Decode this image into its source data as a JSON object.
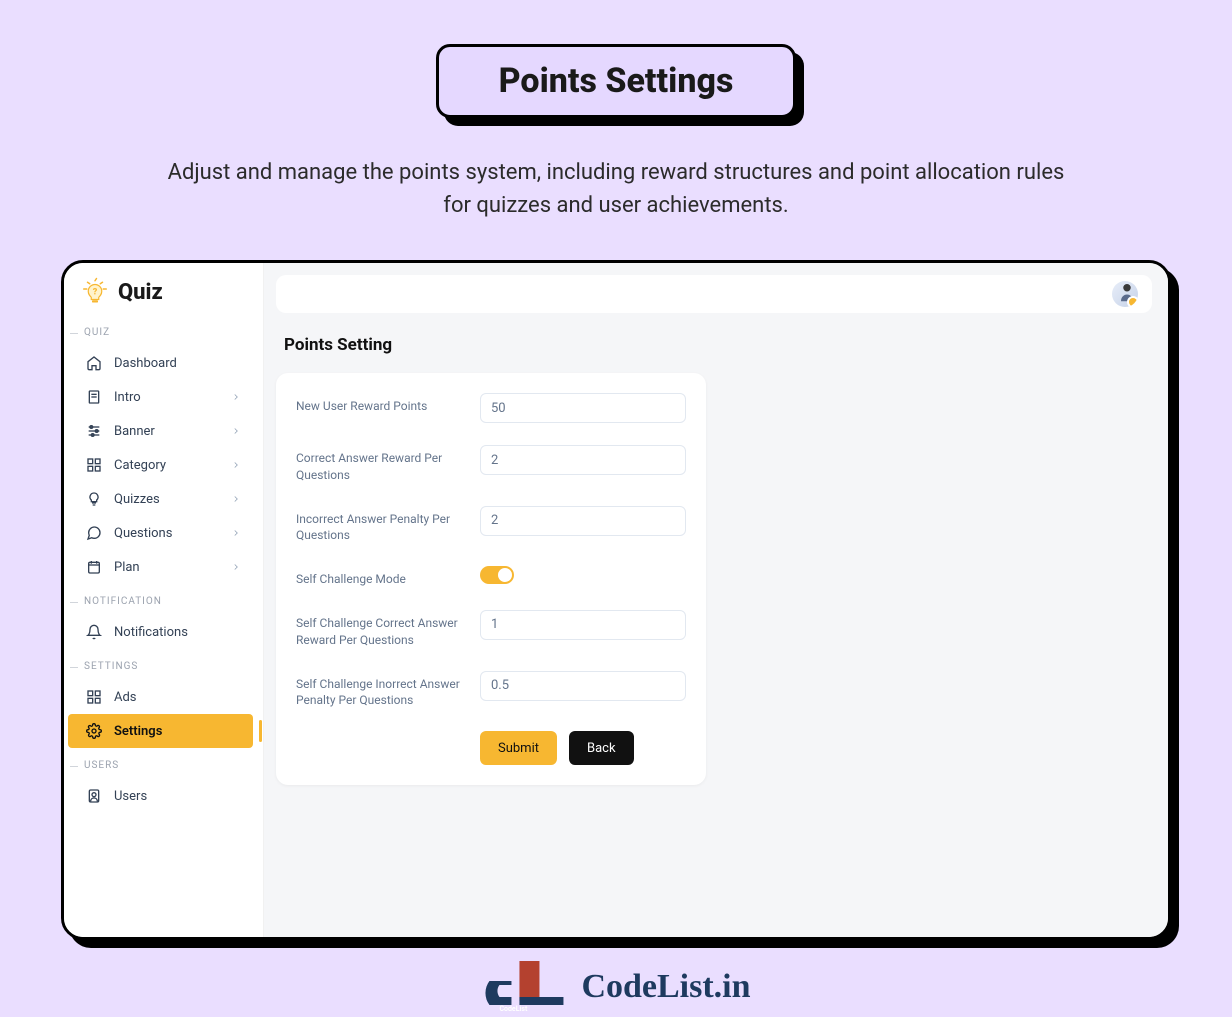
{
  "hero": {
    "title": "Points Settings",
    "subtitle": "Adjust and manage the points system, including reward structures and point allocation rules for quizzes and user achievements."
  },
  "brand": "Quiz",
  "sections": {
    "quiz": "QUIZ",
    "notification": "NOTIFICATION",
    "settings": "SETTINGS",
    "users": "USERS"
  },
  "nav": {
    "dashboard": "Dashboard",
    "intro": "Intro",
    "banner": "Banner",
    "category": "Category",
    "quizzes": "Quizzes",
    "questions": "Questions",
    "plan": "Plan",
    "notifications": "Notifications",
    "ads": "Ads",
    "settings": "Settings",
    "users": "Users"
  },
  "content": {
    "title": "Points Setting"
  },
  "form": {
    "new_user_label": "New User Reward Points",
    "new_user_value": "50",
    "correct_label": "Correct Answer Reward Per Questions",
    "correct_value": "2",
    "incorrect_label": "Incorrect Answer Penalty Per Questions",
    "incorrect_value": "2",
    "self_mode_label": "Self Challenge Mode",
    "self_correct_label": "Self Challenge Correct Answer Reward Per Questions",
    "self_correct_value": "1",
    "self_incorrect_label": "Self Challenge Inorrect Answer Penalty Per Questions",
    "self_incorrect_value": "0.5",
    "submit": "Submit",
    "back": "Back"
  },
  "watermark": "CodeList.in"
}
